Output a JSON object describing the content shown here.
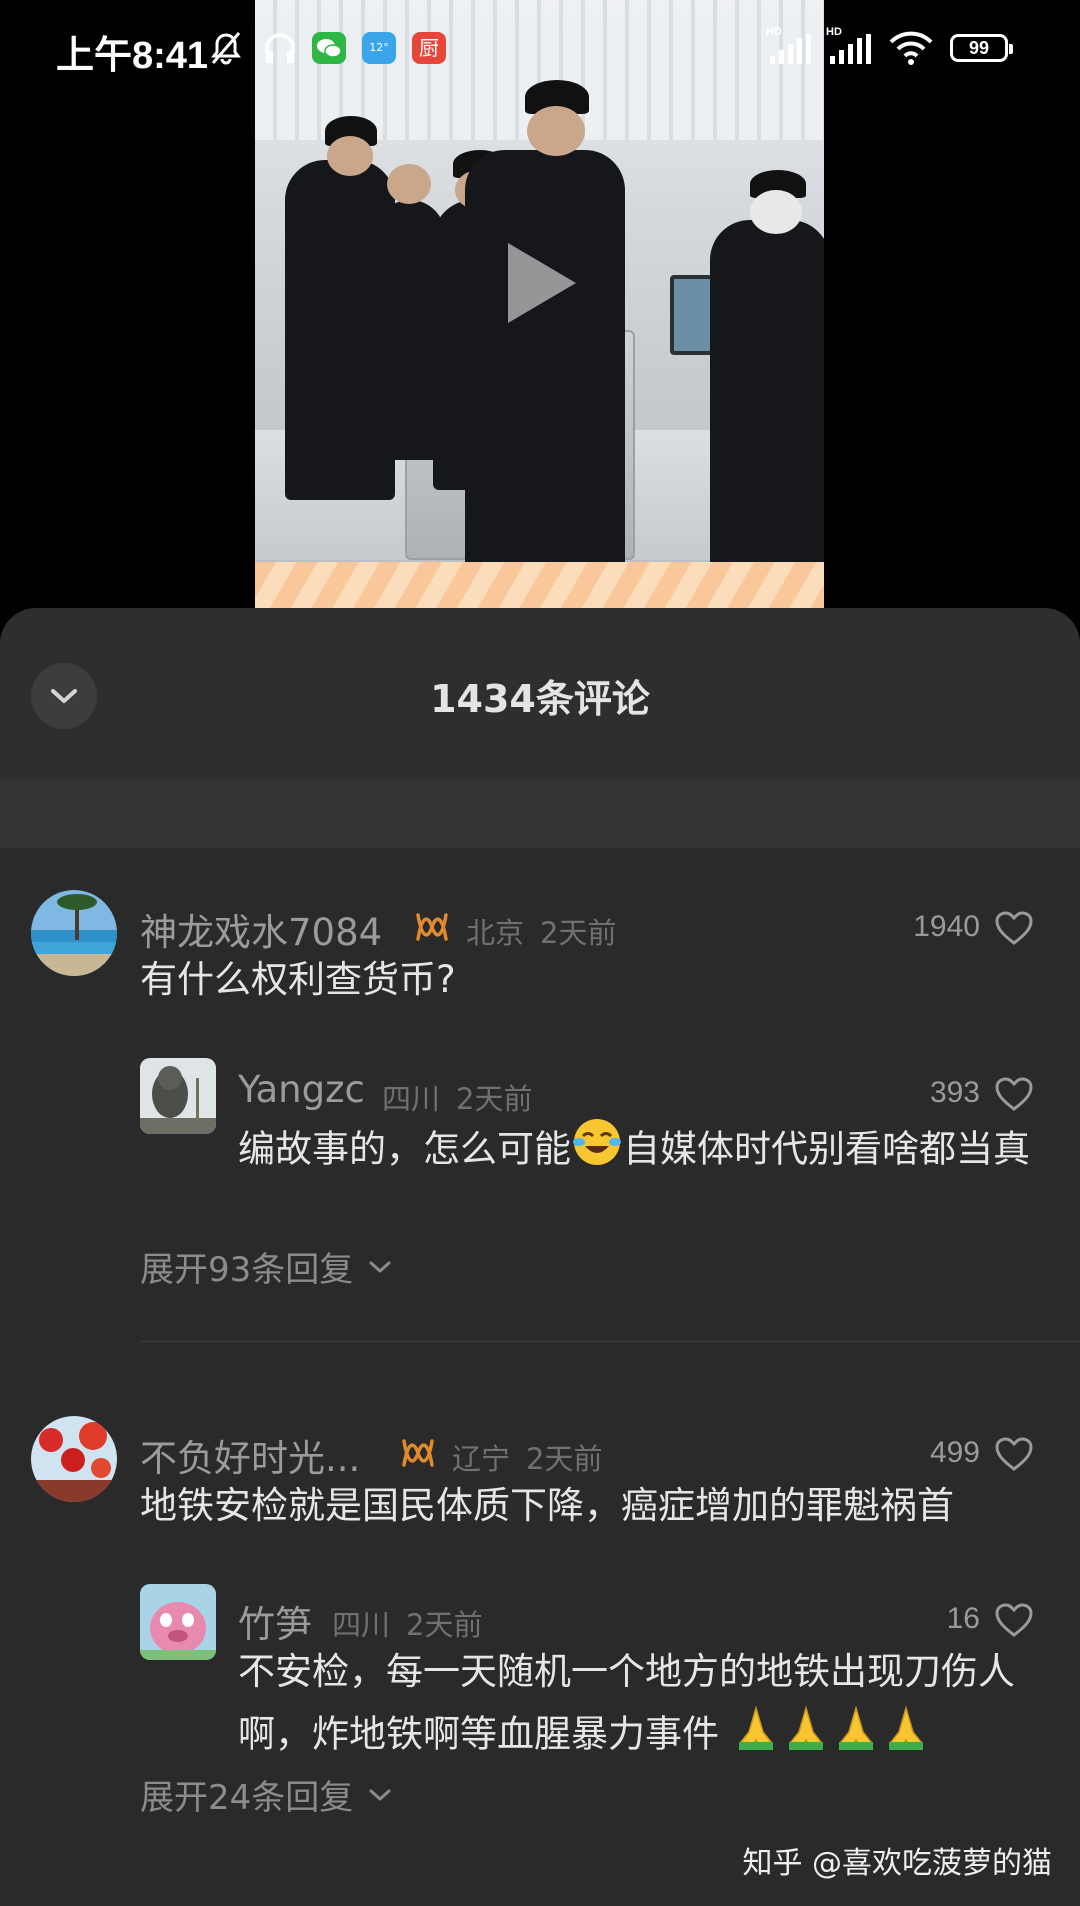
{
  "status_bar": {
    "time": "上午8:41",
    "weather_badge": "12°",
    "kitchen_badge": "厨",
    "signal_hd_1": "HD",
    "signal_hd_2": "HD",
    "battery": "99"
  },
  "panel": {
    "title": "1434条评论"
  },
  "comments": [
    {
      "username": "神龙戏水7084",
      "location": "北京",
      "time": "2天前",
      "likes": "1940",
      "text": "有什么权利查货币?",
      "reply": {
        "username": "Yangzc",
        "location": "四川",
        "time": "2天前",
        "likes": "393",
        "text_before": "编故事的，怎么可能",
        "text_after": "自媒体时代别看啥都当真"
      },
      "expand": "展开93条回复"
    },
    {
      "username": "不负好时光...",
      "location": "辽宁",
      "time": "2天前",
      "likes": "499",
      "text": "地铁安检就是国民体质下降，癌症增加的罪魁祸首",
      "reply": {
        "username": "竹笋",
        "location": "四川",
        "time": "2天前",
        "likes": "16",
        "text": "不安检，每一天随机一个地方的地铁出现刀伤人啊，炸地铁啊等血腥暴力事件"
      },
      "expand": "展开24条回复"
    }
  ],
  "watermark": "知乎 @喜欢吃菠萝的猫",
  "colors": {
    "panel_bg": "#2a2a2a",
    "badge_orange": "#e08a2c"
  }
}
